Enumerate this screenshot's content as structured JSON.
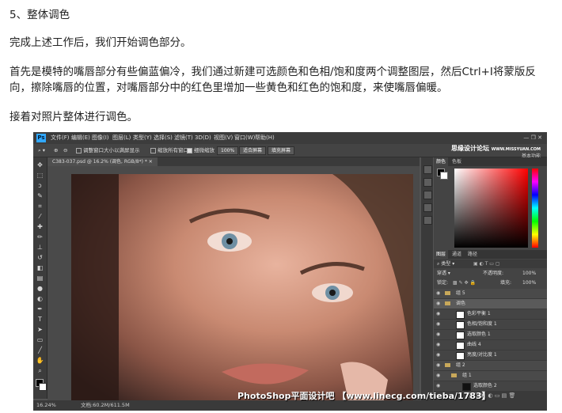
{
  "article": {
    "heading": "5、整体调色",
    "intro": "完成上述工作后，我们开始调色部分。",
    "para_line1": "首先是模特的嘴唇部分有些偏蓝偏冷，我们通过新建可选颜色和色相/饱和度两个调整图层，然后Ctrl+I将蒙版反",
    "para_line2": "向，擦除嘴唇的位置，对嘴唇部分中的红色里增加一些黄色和红色的饱和度，来使嘴唇偏暖。",
    "para3": "接着对照片整体进行调色。"
  },
  "ps": {
    "logo": "Ps",
    "menu": [
      "文件(F)",
      "编辑(E)",
      "图像(I)",
      "图层(L)",
      "类型(Y)",
      "选择(S)",
      "滤镜(T)",
      "3D(D)",
      "视图(V)",
      "窗口(W)",
      "帮助(H)"
    ],
    "options": {
      "resize_windows": "调整窗口大小以满屏显示",
      "zoom_all": "缩放所有窗口",
      "scrubby_zoom": "细微缩放",
      "zoom_value": "100%",
      "fit_screen": "适合屏幕",
      "fill_screen": "填充屏幕"
    },
    "watermark_top": "思缘设计论坛",
    "watermark_top_sub": "WWW.MISSYUAN.COM",
    "workspace": "基本功能",
    "doc_tab": "C383-037.psd @ 16.2% (调色, RGB/8*) *",
    "status": {
      "zoom": "16.24%",
      "doc": "文档:60.2M/611.5M"
    },
    "panels": {
      "color_tabs": [
        "颜色",
        "色板"
      ],
      "layer_tabs": [
        "图层",
        "通道",
        "路径"
      ],
      "kind": "类型",
      "blend_mode": "穿透",
      "opacity_label": "不透明度:",
      "opacity": "100%",
      "lock_label": "锁定:",
      "fill_label": "填充:",
      "fill": "100%",
      "layers": [
        {
          "name": "组 5",
          "type": "group",
          "indent": 0
        },
        {
          "name": "调色",
          "type": "group",
          "indent": 0,
          "selected": true
        },
        {
          "name": "色彩平衡 1",
          "type": "adj",
          "indent": 1
        },
        {
          "name": "色相/饱和度 1",
          "type": "adj",
          "indent": 1
        },
        {
          "name": "选取颜色 1",
          "type": "adj",
          "indent": 1
        },
        {
          "name": "曲线 4",
          "type": "adj",
          "indent": 1
        },
        {
          "name": "亮度/对比度 1",
          "type": "adj",
          "indent": 1
        },
        {
          "name": "组 2",
          "type": "group",
          "indent": 0
        },
        {
          "name": "组 1",
          "type": "group",
          "indent": 1
        },
        {
          "name": "选取颜色 2",
          "type": "adj",
          "indent": 2
        }
      ]
    },
    "watermark_bottom": "PhotoShop平面设计吧 【www.linecg.com/tieba/1783】"
  }
}
